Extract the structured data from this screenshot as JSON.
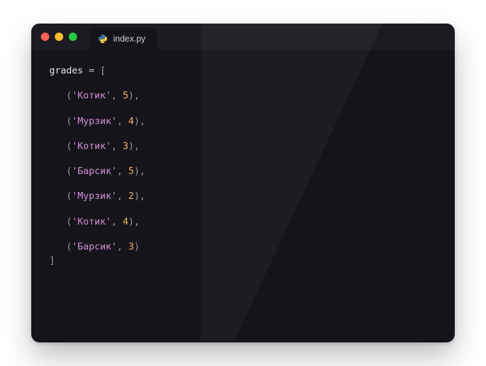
{
  "tab": {
    "filename": "index.py"
  },
  "colors": {
    "traffic_red": "#ff5f56",
    "traffic_yellow": "#ffbd2e",
    "traffic_green": "#27c93f",
    "bg_window": "#15141b",
    "bg_titlebar": "#1c1b22",
    "string": "#d38fd6",
    "number": "#f0b866",
    "default_text": "#e6e6e6",
    "punctuation": "#9a97a6"
  },
  "code": {
    "var_name": "grades",
    "assign": " = ",
    "open_bracket": "[",
    "close_bracket": "]",
    "tuple_open": "(",
    "tuple_close_comma": "),",
    "tuple_close": ")",
    "sep": ", ",
    "entries": [
      {
        "name": "'Котик'",
        "value": "5",
        "trailing_comma": true
      },
      {
        "name": "'Мурзик'",
        "value": "4",
        "trailing_comma": true
      },
      {
        "name": "'Котик'",
        "value": "3",
        "trailing_comma": true
      },
      {
        "name": "'Барсик'",
        "value": "5",
        "trailing_comma": true
      },
      {
        "name": "'Мурзик'",
        "value": "2",
        "trailing_comma": true
      },
      {
        "name": "'Котик'",
        "value": "4",
        "trailing_comma": true
      },
      {
        "name": "'Барсик'",
        "value": "3",
        "trailing_comma": false
      }
    ]
  }
}
